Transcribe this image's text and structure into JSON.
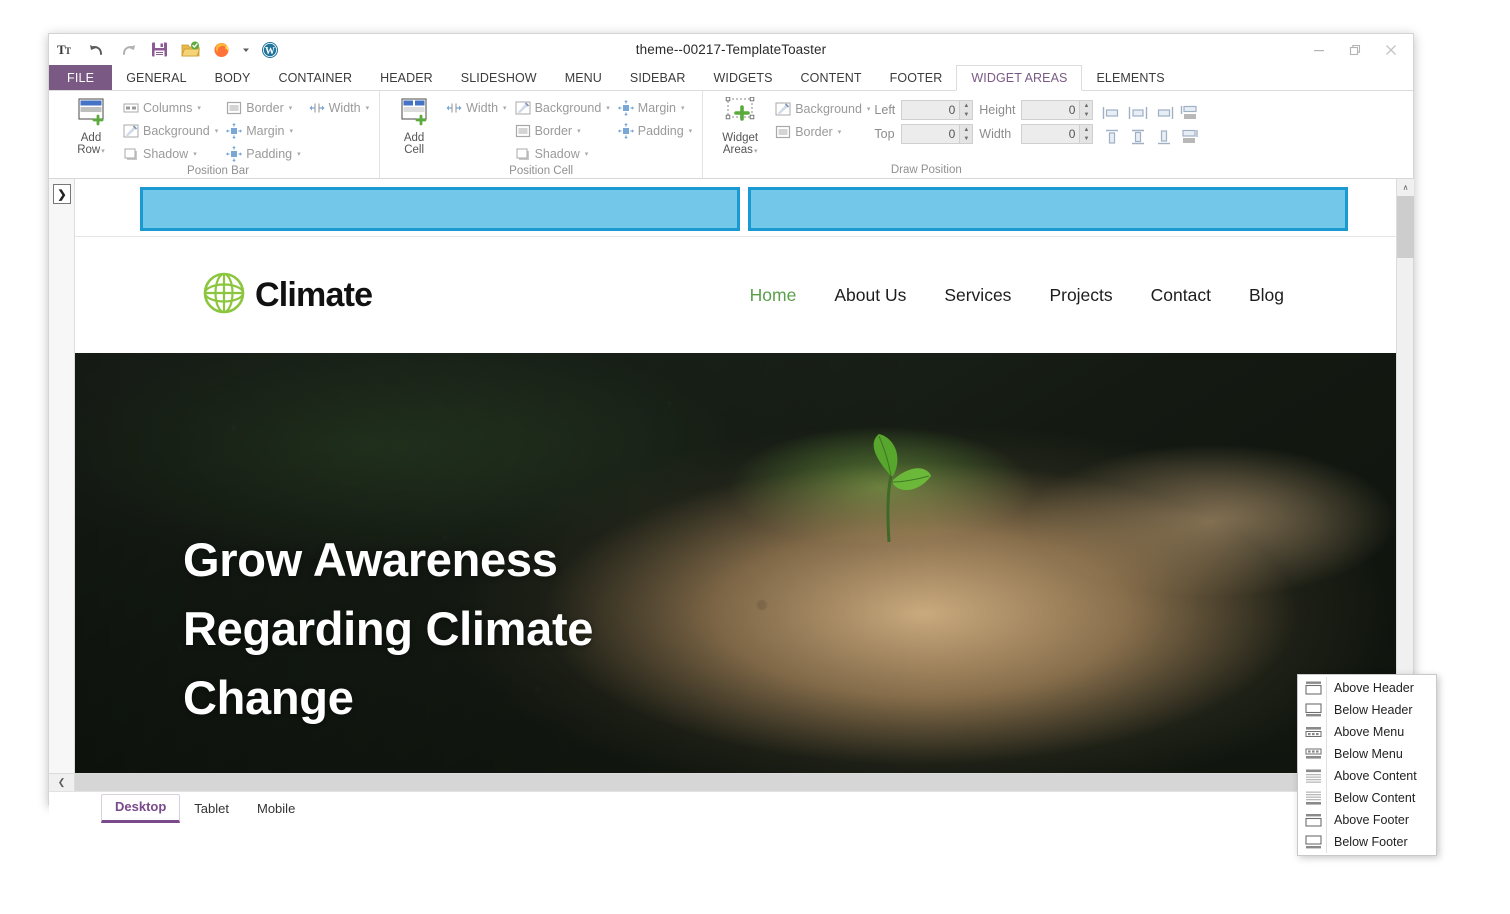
{
  "window": {
    "title": "theme--00217-TemplateToaster",
    "minimize_label": "–",
    "restore_label": "❐",
    "close_label": "✕",
    "help_label": "?"
  },
  "quick_access": [
    {
      "name": "text-tool-icon",
      "label": "Tᴛ"
    },
    {
      "name": "undo-icon",
      "label": "Undo"
    },
    {
      "name": "redo-icon",
      "label": "Redo"
    },
    {
      "name": "save-icon",
      "label": "Save"
    },
    {
      "name": "export-icon",
      "label": "Export"
    },
    {
      "name": "firefox-preview-icon",
      "label": "Preview in Firefox"
    },
    {
      "name": "preview-dropdown-caret",
      "label": "▾"
    },
    {
      "name": "wordpress-icon",
      "label": "WordPress"
    }
  ],
  "ribbon": {
    "file_tab": "FILE",
    "tabs": [
      "GENERAL",
      "BODY",
      "CONTAINER",
      "HEADER",
      "SLIDESHOW",
      "MENU",
      "SIDEBAR",
      "WIDGETS",
      "CONTENT",
      "FOOTER",
      "WIDGET AREAS",
      "ELEMENTS"
    ],
    "active_tab": "WIDGET AREAS",
    "groups": [
      {
        "title": "Position Bar",
        "big_button": {
          "label_line1": "Add",
          "label_line2": "Row",
          "caret": "▾"
        },
        "col1": [
          {
            "label": "Columns",
            "caret": "▾",
            "icon": "columns-icon"
          },
          {
            "label": "Background",
            "caret": "▾",
            "icon": "background-icon"
          },
          {
            "label": "Shadow",
            "caret": "▾",
            "icon": "shadow-icon"
          }
        ],
        "col2": [
          {
            "label": "Border",
            "caret": "▾",
            "icon": "border-icon"
          },
          {
            "label": "Margin",
            "caret": "▾",
            "icon": "margin-icon"
          },
          {
            "label": "Padding",
            "caret": "▾",
            "icon": "padding-icon"
          }
        ],
        "col3": [
          {
            "label": "Width",
            "caret": "▾",
            "icon": "width-icon"
          }
        ]
      },
      {
        "title": "Position Cell",
        "big_button": {
          "label_line1": "Add",
          "label_line2": "Cell",
          "caret": ""
        },
        "col1": [
          {
            "label": "Width",
            "caret": "▾",
            "icon": "width-icon"
          }
        ],
        "col2": [
          {
            "label": "Background",
            "caret": "▾",
            "icon": "background-icon"
          },
          {
            "label": "Border",
            "caret": "▾",
            "icon": "border-icon"
          },
          {
            "label": "Shadow",
            "caret": "▾",
            "icon": "shadow-icon"
          }
        ],
        "col3": [
          {
            "label": "Margin",
            "caret": "▾",
            "icon": "margin-icon"
          },
          {
            "label": "Padding",
            "caret": "▾",
            "icon": "padding-icon"
          }
        ]
      },
      {
        "title": "Draw Position",
        "big_button": {
          "label_line1": "Widget",
          "label_line2": "Areas",
          "caret": "▾"
        },
        "col1": [
          {
            "label": "Background",
            "caret": "▾",
            "icon": "background-icon"
          },
          {
            "label": "Border",
            "caret": "▾",
            "icon": "border-icon"
          }
        ],
        "fields": [
          {
            "label": "Left",
            "value": "0"
          },
          {
            "label": "Height",
            "value": "0"
          },
          {
            "label": "Top",
            "value": "0"
          },
          {
            "label": "Width",
            "value": "0"
          }
        ],
        "align_icons": [
          "align-left-icon",
          "align-center-icon",
          "align-right-icon",
          "align-stretch-horizontal-icon",
          "align-top-icon",
          "align-middle-icon",
          "align-bottom-icon",
          "align-stretch-vertical-icon"
        ]
      }
    ]
  },
  "canvas": {
    "expand_rail_label": "❯",
    "widget_areas": [
      {
        "name": "widget-area-left"
      },
      {
        "name": "widget-area-right"
      }
    ],
    "site": {
      "logo_text": "Climate",
      "logo_icon": "globe-icon",
      "nav": [
        {
          "label": "Home",
          "active": true
        },
        {
          "label": "About Us",
          "active": false
        },
        {
          "label": "Services",
          "active": false
        },
        {
          "label": "Projects",
          "active": false
        },
        {
          "label": "Contact",
          "active": false
        },
        {
          "label": "Blog",
          "active": false
        }
      ],
      "hero_title": "Grow Awareness Regarding Climate Change",
      "scroll_top_icon": "double-chevron-up-icon"
    }
  },
  "scrollbars": {
    "v_up": "∧",
    "v_down": "∨",
    "h_left": "❮",
    "h_right": "❯"
  },
  "statusbar": {
    "device_tabs": [
      {
        "label": "Desktop",
        "active": true
      },
      {
        "label": "Tablet",
        "active": false
      },
      {
        "label": "Mobile",
        "active": false
      }
    ]
  },
  "popup_menu": {
    "items": [
      {
        "label": "Above Header",
        "icon": "above-header-icon"
      },
      {
        "label": "Below Header",
        "icon": "below-header-icon"
      },
      {
        "label": "Above Menu",
        "icon": "above-menu-icon"
      },
      {
        "label": "Below Menu",
        "icon": "below-menu-icon"
      },
      {
        "label": "Above Content",
        "icon": "above-content-icon"
      },
      {
        "label": "Below Content",
        "icon": "below-content-icon"
      },
      {
        "label": "Above Footer",
        "icon": "above-footer-icon"
      },
      {
        "label": "Below Footer",
        "icon": "below-footer-icon"
      }
    ]
  },
  "colors": {
    "accent_purple": "#7a5a85",
    "widget_area_fill": "#73c7e8",
    "widget_area_border": "#1a9ad1",
    "nav_active_green": "#5a9e4a",
    "logo_green": "#8cc63f"
  }
}
